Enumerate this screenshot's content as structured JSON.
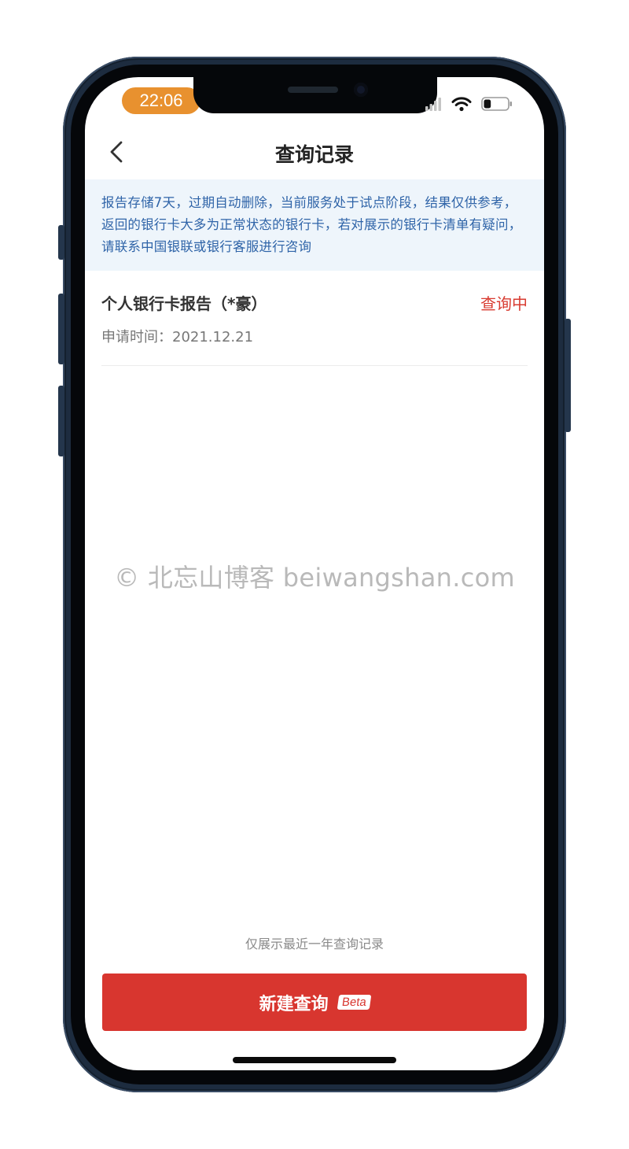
{
  "status_bar": {
    "time": "22:06",
    "battery_level": 0.3
  },
  "nav": {
    "title": "查询记录"
  },
  "notice": {
    "text": "报告存储7天，过期自动删除，当前服务处于试点阶段，结果仅供参考，返回的银行卡大多为正常状态的银行卡，若对展示的银行卡清单有疑问，请联系中国银联或银行客服进行咨询"
  },
  "records": [
    {
      "title": "个人银行卡报告（*豪）",
      "status": "查询中",
      "date": "申请时间：2021.12.21"
    }
  ],
  "watermark": "© 北忘山博客 beiwangshan.com",
  "footer_note": "仅展示最近一年查询记录",
  "new_query_button": {
    "label": "新建查询",
    "badge": "Beta"
  },
  "colors": {
    "accent_red": "#d8362f",
    "notice_bg": "#eef5fb",
    "notice_text": "#2f64a8",
    "time_pill": "#e8912f"
  }
}
